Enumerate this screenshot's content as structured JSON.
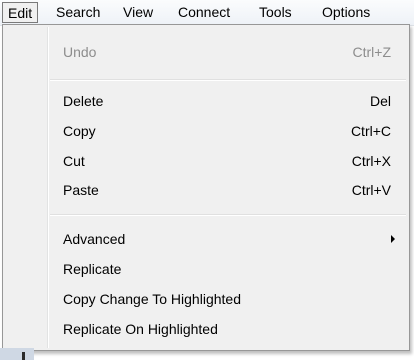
{
  "menubar": {
    "items": [
      {
        "label": "Edit",
        "active": true
      },
      {
        "label": "Search",
        "active": false
      },
      {
        "label": "View",
        "active": false
      },
      {
        "label": "Connect",
        "active": false
      },
      {
        "label": "Tools",
        "active": false
      },
      {
        "label": "Options",
        "active": false
      }
    ]
  },
  "edit_menu": {
    "items": [
      {
        "label": "Undo",
        "shortcut": "Ctrl+Z",
        "enabled": false
      },
      {
        "label": "Delete",
        "shortcut": "Del",
        "enabled": true
      },
      {
        "label": "Copy",
        "shortcut": "Ctrl+C",
        "enabled": true
      },
      {
        "label": "Cut",
        "shortcut": "Ctrl+X",
        "enabled": true
      },
      {
        "label": "Paste",
        "shortcut": "Ctrl+V",
        "enabled": true
      },
      {
        "label": "Advanced",
        "submenu": true,
        "enabled": true
      },
      {
        "label": "Replicate",
        "enabled": true
      },
      {
        "label": "Copy Change To Highlighted",
        "enabled": true
      },
      {
        "label": "Replicate On Highlighted",
        "enabled": true
      }
    ]
  },
  "icons": {
    "submenu_arrow": "chevron-right-icon"
  },
  "colors": {
    "menu_background": "#f0f0f0",
    "disabled_text": "#8d8d8d",
    "active_border": "#7a7a7a"
  }
}
